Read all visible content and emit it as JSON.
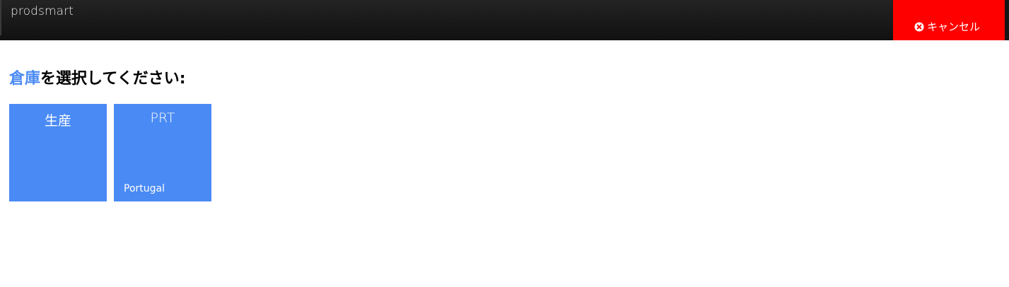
{
  "app": {
    "brand": "prodsmart"
  },
  "header": {
    "cancel_label": "キャンセル",
    "cancel_icon": "times-circle-icon"
  },
  "main": {
    "heading_accent": "倉庫",
    "heading_rest": "を選択してください:",
    "warehouses": [
      {
        "title": "生産",
        "subtitle": ""
      },
      {
        "title": "PRT",
        "subtitle": "Portugal"
      }
    ]
  },
  "colors": {
    "topbar": "#1a1a1a",
    "cancel": "#ff0000",
    "accent": "#4a8af4",
    "tile": "#4a8af4"
  }
}
